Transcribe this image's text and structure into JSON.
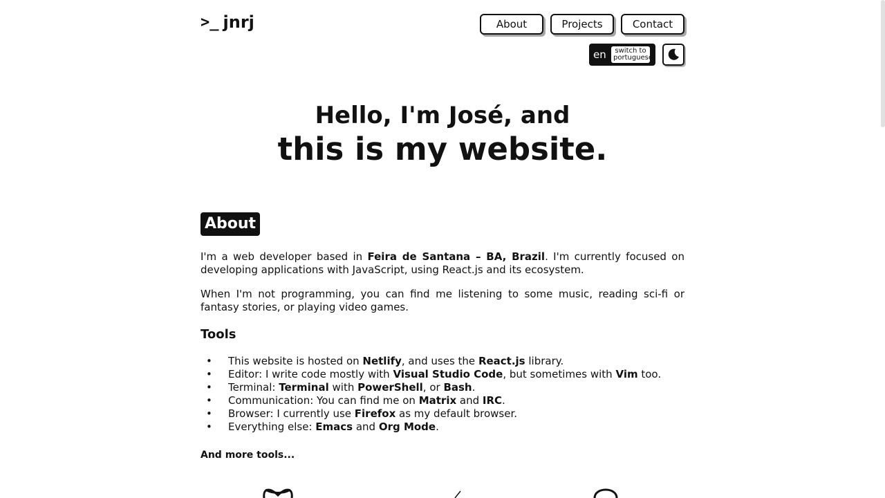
{
  "logo": {
    "prompt": ">_",
    "name": "jnrj"
  },
  "nav": {
    "items": [
      "About",
      "Projects",
      "Contact"
    ]
  },
  "lang": {
    "code": "en",
    "switch_line1": "switch to",
    "switch_line2": "portuguese"
  },
  "theme_icon": "moon-icon",
  "hero": {
    "line1": "Hello, I'm José, and",
    "line2": "this is my website."
  },
  "about": {
    "title": "About",
    "p1_a": "I'm a web developer based in ",
    "p1_b": "Feira de Santana – BA, Brazil",
    "p1_c": ". I'm currently focused on developing applications with JavaScript, using React.js and its ecosystem.",
    "p2": "When I'm not programming, you can find me listening to some music, reading sci-fi or fantasy stories, or playing video games."
  },
  "tools": {
    "title": "Tools",
    "items": [
      [
        "This website is hosted on ",
        "Netlify",
        ", and uses the ",
        "React.js",
        " library."
      ],
      [
        "Editor: I write code mostly with ",
        "Visual Studio Code",
        ", but sometimes with ",
        "Vim",
        " too."
      ],
      [
        "Terminal: ",
        "Terminal",
        " with ",
        "PowerShell",
        ", or ",
        "Bash",
        "."
      ],
      [
        "Communication: You can find me on ",
        "Matrix",
        " and ",
        "IRC",
        "."
      ],
      [
        "Browser: I currently use ",
        "Firefox",
        " as my default browser."
      ],
      [
        "Everything else: ",
        "Emacs",
        " and ",
        "Org Mode",
        "."
      ]
    ],
    "more": "And more tools..."
  },
  "colors": {
    "text": "#111111",
    "background": "#ffffff"
  }
}
